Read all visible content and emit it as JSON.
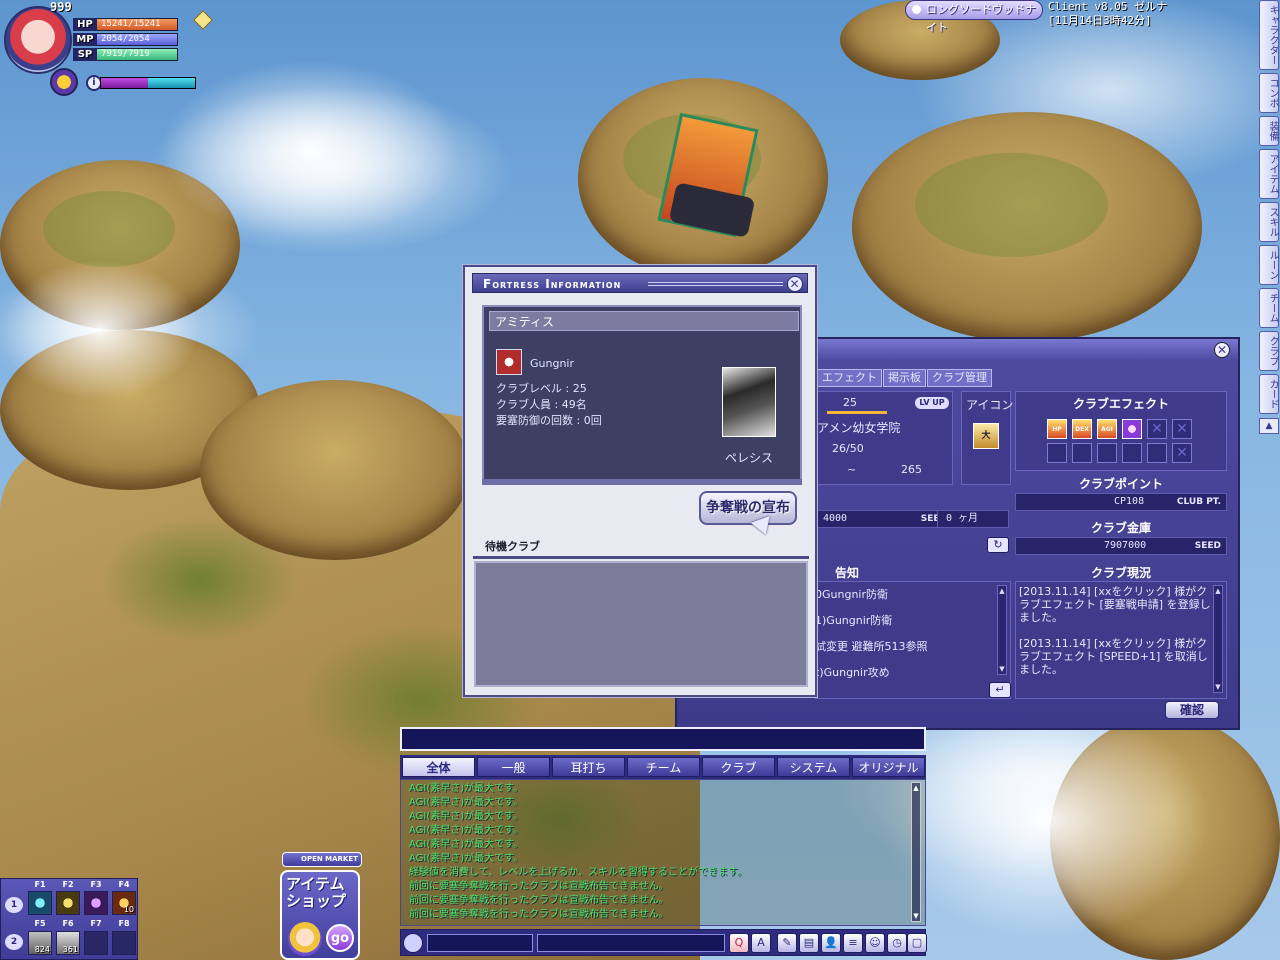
{
  "character": {
    "level": "999",
    "hp": {
      "label": "HP",
      "value": "15241/15241"
    },
    "mp": {
      "label": "MP",
      "value": "2054/2054"
    },
    "sp": {
      "label": "SP",
      "value": "7919/7919"
    },
    "exp_fraction": 0.5,
    "info_icon": "i"
  },
  "server": {
    "name": "ロングソードヴッドナイト",
    "client_version": "Client v8.05 ゼルナ",
    "time": "[11月14日3時42分]"
  },
  "side_tabs": [
    "キャラクター",
    "コンボ",
    "装備",
    "アイテム",
    "スキル",
    "ルーン",
    "チーム",
    "クラブ",
    "カード"
  ],
  "side_arrow": "▲",
  "fortress": {
    "title": "Fortress Information",
    "fortress_name": "アミティス",
    "club_name": "Gungnir",
    "club_level": "クラブレベル : 25",
    "club_members": "クラブ人員 : 49名",
    "defense_count": "要塞防御の回数 : 0回",
    "guardian_name": "ペレシス",
    "declare_button": "争奪戦の宣布",
    "waiting_clubs_label": "待機クラブ",
    "close": "✕"
  },
  "club": {
    "close": "✕",
    "tabs": [
      "エフェクト",
      "掲示板",
      "クラブ管理"
    ],
    "level_value": "25",
    "lvup": "LV UP",
    "school": "アメン幼女学院",
    "members": "26/50",
    "range_sep": "~",
    "range_value": "265",
    "icon_label": "アイコン",
    "icon_text": "大",
    "seed_value": "4000",
    "seed_unit": "SEED",
    "months": "0 ヶ月",
    "effect_title": "クラブエフェクト",
    "effects": [
      "HP",
      "DEX",
      "AGI",
      "",
      "",
      "",
      "",
      "",
      "",
      "",
      "",
      ""
    ],
    "point_title": "クラブポイント",
    "point_value": "CP108",
    "point_unit": "CLUB PT.",
    "vault_title": "クラブ金庫",
    "vault_value": "7907000",
    "vault_unit": "SEED",
    "notice_title": "告知",
    "notices": [
      "0Gungnir防衛",
      "1)Gungnir防衛",
      "試変更 避難所513参照",
      "t)Gungnir攻め"
    ],
    "status_title": "クラブ現況",
    "logs": [
      "[2013.11.14] [xxをクリック] 様がクラブエフェクト [要塞戦申請] を登録しました。",
      "[2013.11.14] [xxをクリック] 様がクラブエフェクト [SPEED+1] を取消しました。"
    ],
    "confirm": "確認",
    "refresh_icon": "↻",
    "enter_icon": "↵"
  },
  "chat": {
    "tabs": [
      "全体",
      "一般",
      "耳打ち",
      "チーム",
      "クラブ",
      "システム",
      "オリジナル"
    ],
    "active_tab": 0,
    "lines": [
      "AGI(素早さ)が最大です。",
      "AGI(素早さ)が最大です。",
      "AGI(素早さ)が最大です。",
      "AGI(素早さ)が最大です。",
      "AGI(素早さ)が最大です。",
      "AGI(素早さ)が最大です。",
      "経験値を消費して、レベルを上げるか、スキルを習得することができます。",
      "前回に要塞争奪戦を行ったクラブは宣戦布告できません。",
      "前回に要塞争奪戦を行ったクラブは宣戦布告できません。",
      "前回に要塞争奪戦を行ったクラブは宣戦布告できません。"
    ],
    "line_color": "#4fe069",
    "bottom_icons": [
      "Q",
      "A",
      "✎",
      "▤",
      "👤",
      "≡",
      "☺",
      "◷",
      "▢"
    ]
  },
  "hotkeys": {
    "row1": "1",
    "row2": "2",
    "labels_top": [
      "F1",
      "F2",
      "F3",
      "F4"
    ],
    "labels_bottom": [
      "F5",
      "F6",
      "F7",
      "F8"
    ],
    "counts_top": [
      "",
      "",
      "",
      "10"
    ],
    "counts_bottom": [
      "824",
      "361",
      "",
      ""
    ]
  },
  "shop": {
    "market": "OPEN MARKET",
    "label": "アイテムショップ",
    "go": "go"
  }
}
